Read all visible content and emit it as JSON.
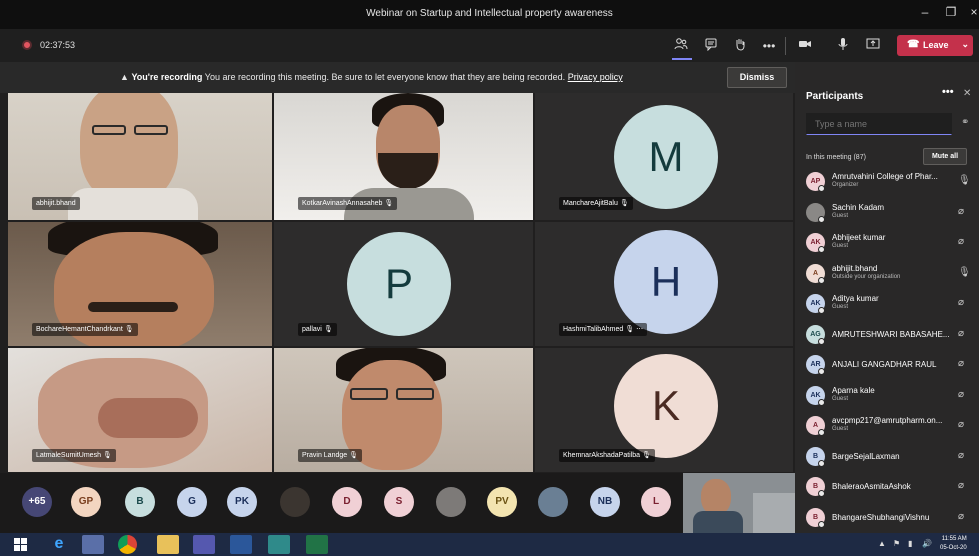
{
  "window": {
    "title": "Webinar on Startup and Intellectual property awareness"
  },
  "toolbar": {
    "timer": "02:37:53",
    "leave_label": "Leave",
    "icons": [
      "participants-icon",
      "chat-icon",
      "raise-hand-icon",
      "more-icon",
      "camera-icon",
      "microphone-icon",
      "share-icon"
    ]
  },
  "banner": {
    "strong": "You're recording",
    "message": "You are recording this meeting. Be sure to let everyone know that they are being recorded.",
    "link": "Privacy policy",
    "dismiss": "Dismiss"
  },
  "tiles": [
    {
      "name": "abhijit.bhand"
    },
    {
      "name": "KotkarAvinashAnnasaheb"
    },
    {
      "name": "ManchareAjitBalu",
      "initial": "M"
    },
    {
      "name": "BochareHemantChandrkant"
    },
    {
      "name": "pallavi",
      "initial": "P"
    },
    {
      "name": "HashmiTalibAhmed",
      "initial": "H"
    },
    {
      "name": "LatmaleSumitUmesh"
    },
    {
      "name": "Pravin Landge"
    },
    {
      "name": "KhemnarAkshadaPatilba",
      "initial": "K"
    }
  ],
  "strip": {
    "overflow": "+65",
    "chips": [
      "GP",
      "B",
      "G",
      "PK",
      "",
      "D",
      "S",
      "",
      "PV",
      "",
      "NB",
      "L"
    ]
  },
  "panel": {
    "title": "Participants",
    "search_placeholder": "Type a name",
    "in_meeting": "In this meeting (87)",
    "mute_all": "Mute all",
    "participants": [
      {
        "initials": "AP",
        "name": "Amrutvahini College of Phar...",
        "sub": "Organizer"
      },
      {
        "initials": "",
        "name": "Sachin Kadam",
        "sub": "Guest"
      },
      {
        "initials": "AK",
        "name": "Abhijeet kumar",
        "sub": "Guest"
      },
      {
        "initials": "A",
        "name": "abhijit.bhand",
        "sub": "Outside your organization"
      },
      {
        "initials": "AK",
        "name": "Aditya kumar",
        "sub": "Guest"
      },
      {
        "initials": "AG",
        "name": "AMRUTESHWARI BABASAHE...",
        "sub": ""
      },
      {
        "initials": "AR",
        "name": "ANJALI GANGADHAR RAUL",
        "sub": ""
      },
      {
        "initials": "AK",
        "name": "Aparna kale",
        "sub": "Guest"
      },
      {
        "initials": "A",
        "name": "avcpmp217@amrutpharm.on...",
        "sub": "Guest"
      },
      {
        "initials": "B",
        "name": "BargeSejalLaxman",
        "sub": ""
      },
      {
        "initials": "B",
        "name": "BhaleraoAsmitaAshok",
        "sub": ""
      },
      {
        "initials": "B",
        "name": "BhangareShubhangiVishnu",
        "sub": ""
      }
    ]
  },
  "taskbar": {
    "time": "11:55 AM",
    "date": "05-Oct-20"
  }
}
